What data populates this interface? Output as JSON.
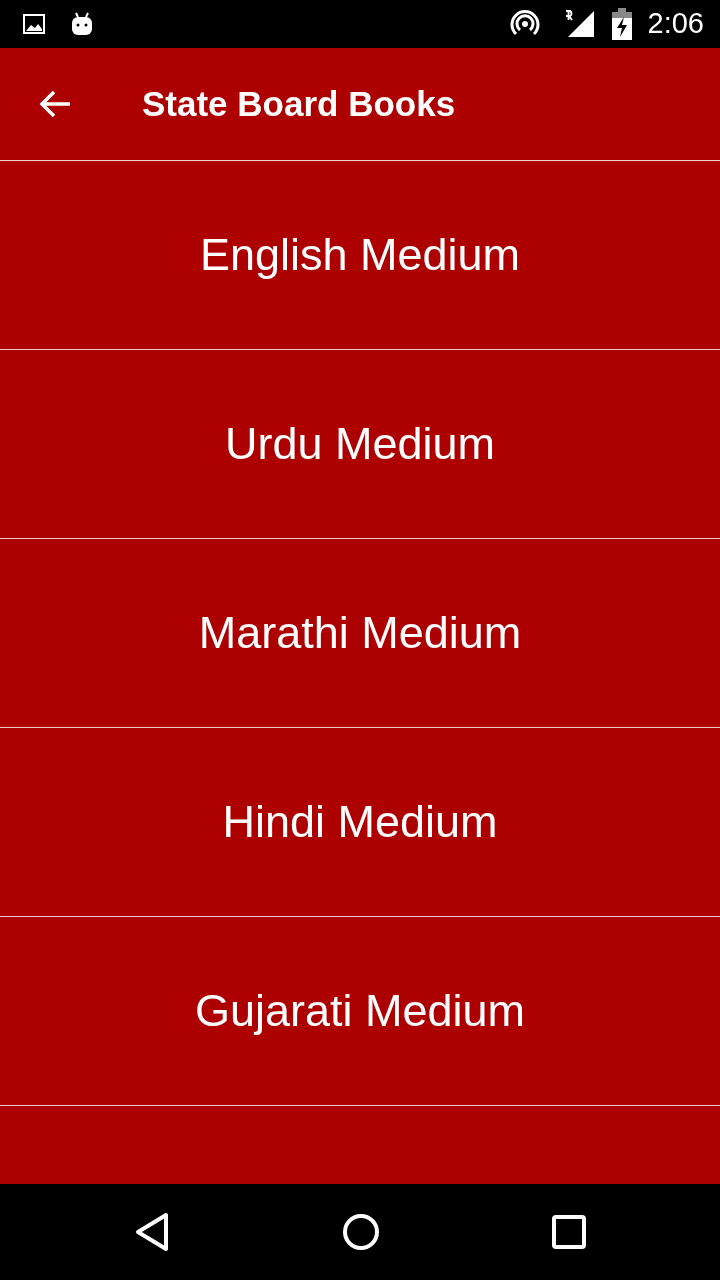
{
  "status_bar": {
    "time": "2:06"
  },
  "app_bar": {
    "title": "State Board Books"
  },
  "items": [
    {
      "label": "English Medium"
    },
    {
      "label": "Urdu Medium"
    },
    {
      "label": "Marathi Medium"
    },
    {
      "label": "Hindi Medium"
    },
    {
      "label": "Gujarati Medium"
    }
  ]
}
